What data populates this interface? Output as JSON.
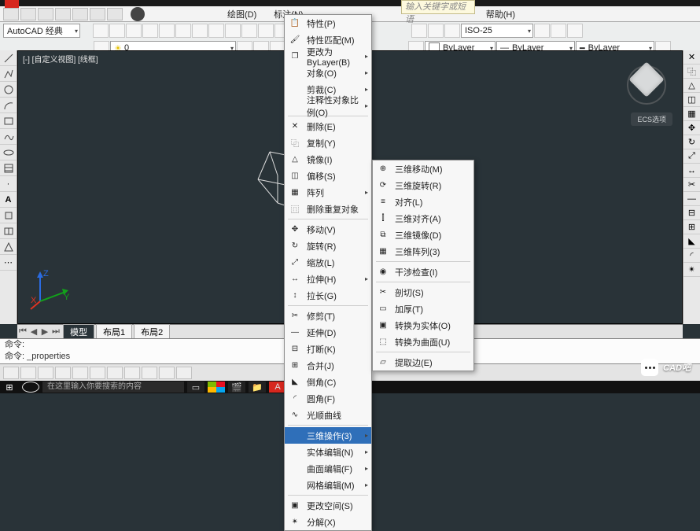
{
  "titlebar": {
    "icon": "A"
  },
  "menubar": {
    "items": [
      "绘图(D)",
      "标注(N)"
    ],
    "right_items": [
      "帮助(H)"
    ]
  },
  "search_top": {
    "placeholder": "输入关键字或短语"
  },
  "ribbon": {
    "workspace": "AutoCAD 经典",
    "layer": "0",
    "dimstyle": "ISO-25",
    "bylayer1": "ByLayer",
    "bylayer2": "ByLayer",
    "bylayer3": "ByLayer"
  },
  "viewport_label": "[-] [自定义视图] [线框]",
  "ecs_button": "ECS选项",
  "model_tabs": {
    "active": "模型",
    "layouts": [
      "布局1",
      "布局2"
    ]
  },
  "cmd": {
    "line1": "命令:",
    "line2": "命令: _properties"
  },
  "menu_main": {
    "items": [
      {
        "label": "特性(P)",
        "ico": "📋"
      },
      {
        "label": "特性匹配(M)",
        "ico": "🖌"
      },
      {
        "label": "更改为 ByLayer(B)",
        "ico": "❐",
        "sub": true
      },
      {
        "label": "对象(O)",
        "sub": true
      },
      {
        "label": "剪裁(C)",
        "sub": true
      },
      {
        "label": "注释性对象比例(O)",
        "sub": true
      },
      {
        "sep": true
      },
      {
        "label": "删除(E)",
        "ico": "✕"
      },
      {
        "label": "复制(Y)",
        "ico": "⿻"
      },
      {
        "label": "镜像(I)",
        "ico": "△"
      },
      {
        "label": "偏移(S)",
        "ico": "◫"
      },
      {
        "label": "阵列",
        "ico": "▦",
        "sub": true
      },
      {
        "label": "删除重复对象",
        "ico": "⿵"
      },
      {
        "sep": true
      },
      {
        "label": "移动(V)",
        "ico": "✥"
      },
      {
        "label": "旋转(R)",
        "ico": "↻"
      },
      {
        "label": "缩放(L)",
        "ico": "⤢"
      },
      {
        "label": "拉伸(H)",
        "ico": "↔",
        "sub": true
      },
      {
        "label": "拉长(G)",
        "ico": "↕"
      },
      {
        "sep": true
      },
      {
        "label": "修剪(T)",
        "ico": "✂"
      },
      {
        "label": "延伸(D)",
        "ico": "—"
      },
      {
        "label": "打断(K)",
        "ico": "⊟"
      },
      {
        "label": "合并(J)",
        "ico": "⊞"
      },
      {
        "label": "倒角(C)",
        "ico": "◣"
      },
      {
        "label": "圆角(F)",
        "ico": "◜"
      },
      {
        "label": "光顺曲线",
        "ico": "∿"
      },
      {
        "sep": true
      },
      {
        "label": "三维操作(3)",
        "sub": true,
        "hl": true
      },
      {
        "label": "实体编辑(N)",
        "sub": true
      },
      {
        "label": "曲面编辑(F)",
        "sub": true
      },
      {
        "label": "网格编辑(M)",
        "sub": true
      },
      {
        "sep": true
      },
      {
        "label": "更改空间(S)",
        "ico": "▣"
      },
      {
        "label": "分解(X)",
        "ico": "✴"
      }
    ]
  },
  "menu_sub": {
    "items": [
      {
        "label": "三维移动(M)",
        "ico": "⊕"
      },
      {
        "label": "三维旋转(R)",
        "ico": "⟳"
      },
      {
        "label": "对齐(L)",
        "ico": "≡"
      },
      {
        "label": "三维对齐(A)",
        "ico": "⫿"
      },
      {
        "label": "三维镜像(D)",
        "ico": "⧉"
      },
      {
        "label": "三维阵列(3)",
        "ico": "▦"
      },
      {
        "sep": true
      },
      {
        "label": "干涉检查(I)",
        "ico": "◉"
      },
      {
        "sep": true
      },
      {
        "label": "剖切(S)",
        "ico": "✂"
      },
      {
        "label": "加厚(T)",
        "ico": "▭"
      },
      {
        "label": "转换为实体(O)",
        "ico": "▣"
      },
      {
        "label": "转换为曲面(U)",
        "ico": "⬚"
      },
      {
        "sep": true
      },
      {
        "label": "提取边(E)",
        "ico": "▱"
      }
    ]
  },
  "taskbar": {
    "search_placeholder": "在这里输入你要搜索的内容"
  },
  "watermark": "CAD吧"
}
